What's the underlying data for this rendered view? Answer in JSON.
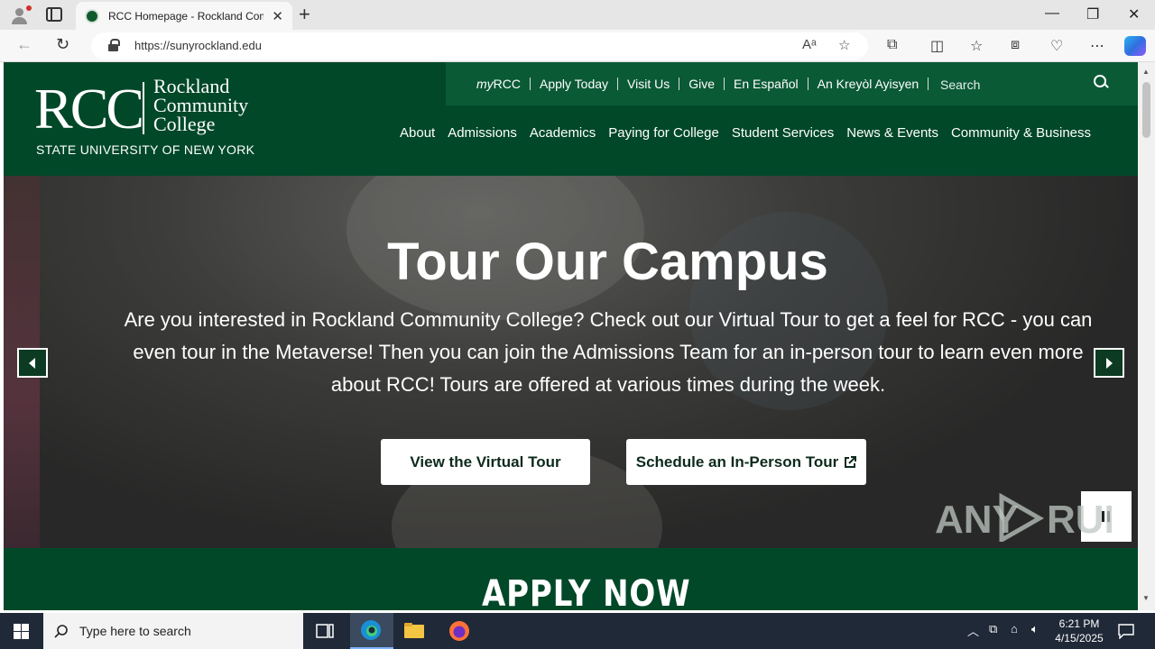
{
  "browser": {
    "tab_title": "RCC Homepage - Rockland Comm",
    "url": "https://sunyrockland.edu"
  },
  "site": {
    "logo_letters": "RCC",
    "logo_name": [
      "Rockland",
      "Community",
      "College"
    ],
    "logo_subtitle": "STATE UNIVERSITY OF NEW YORK",
    "utility_links": [
      {
        "prefix": "my",
        "label": "RCC"
      },
      {
        "label": "Apply Today"
      },
      {
        "label": "Visit Us"
      },
      {
        "label": "Give"
      },
      {
        "label": "En Español"
      },
      {
        "label": "An Kreyòl Ayisyen"
      }
    ],
    "search_placeholder": "Search",
    "main_nav": [
      "About",
      "Admissions",
      "Academics",
      "Paying for College",
      "Student Services",
      "News & Events",
      "Community & Business"
    ],
    "hero": {
      "title": "Tour Our Campus",
      "text": "Are you interested in Rockland Community College? Check out our Virtual Tour to get a feel for RCC - you can even tour in the Metaverse! Then you can join the Admissions Team for an in-person tour to learn even more about RCC! Tours are offered at various times during the week.",
      "button_virtual": "View the Virtual Tour",
      "button_inperson": "Schedule an In-Person Tour"
    },
    "apply_banner": "APPLY NOW"
  },
  "watermark": "ANY RUN",
  "taskbar": {
    "search_placeholder": "Type here to search",
    "time": "6:21 PM",
    "date": "4/15/2025"
  },
  "colors": {
    "brand_green": "#004828",
    "util_green": "#0b5a36"
  }
}
